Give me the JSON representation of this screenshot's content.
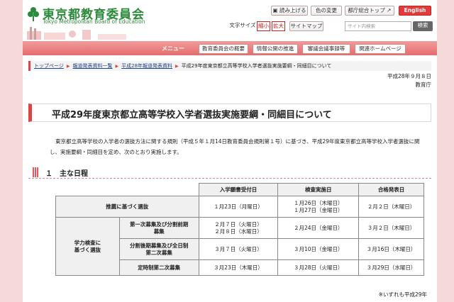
{
  "header": {
    "logo_title": "東京都教育委員会",
    "logo_sub": "Tokyo Metropolitan Board of Education",
    "read_aloud": "読み上げる",
    "color_change": "色の変更",
    "metro_top": "都庁総合トップ",
    "english": "English",
    "font_size_label": "文字サイズ",
    "font_small": "縮小",
    "font_large": "拡大",
    "sitemap": "サイトマップ",
    "search_placeholder": "サイト内検索",
    "search_button": "検索"
  },
  "nav": {
    "menu_label": "メニュー",
    "items": [
      "教育委員会の概要",
      "情報公開の推進",
      "審議会議事録等",
      "関連ホームページ"
    ]
  },
  "breadcrumb": [
    "トップページ",
    "報道発表資料一覧",
    "平成28年報道発表資料",
    "平成29年度東京都立高等学校入学者選抜実施要綱・同細目について"
  ],
  "meta": {
    "date": "平成28年９月８日",
    "org": "教育庁"
  },
  "page_title": "平成29年度東京都立高等学校入学者選抜実施要綱・同細目について",
  "intro": "東京都立高等学校の入学者の選抜方法に関する規則（平成５年１月14日教育委員会規則第１号）に基づき、平成29年度東京都立高等学校入学者選抜に関し、実施要綱・同細目を定め、次のとおり実施します。",
  "section": {
    "num": "１",
    "title": "主な日程"
  },
  "table": {
    "headers": [
      "入学願書受付日",
      "検査実施日",
      "合格発表日"
    ],
    "suisen": {
      "label": "推薦に基づく選抜",
      "apply": "１月23日（月曜日）",
      "exam1": "１月26日（木曜日）",
      "exam2": "１月27日（金曜日）",
      "result": "２月２日（木曜日）"
    },
    "gakuryoku_label_1": "学力検査に",
    "gakuryoku_label_2": "基づく選抜",
    "rows": [
      {
        "name1": "第一次募集及び分割前期",
        "name2": "募集",
        "apply1": "２月７日（火曜日）",
        "apply2": "２月８日（水曜日）",
        "exam": "２月24日（金曜日）",
        "result": "３月２日（木曜日）"
      },
      {
        "name1": "分割後期募集及び全日制",
        "name2": "第二次募集",
        "apply1": "３月７日（火曜日）",
        "apply2": "",
        "exam": "３月10日（金曜日）",
        "result": "３月16日（木曜日）"
      },
      {
        "name1": "定時制第二次募集",
        "name2": "",
        "apply1": "３月23日（木曜日）",
        "apply2": "",
        "exam": "３月28日（火曜日）",
        "result": "３月29日（水曜日）"
      }
    ]
  },
  "footnote": "※いずれも平成29年",
  "colors": {
    "brand_green": "#2c8a3b",
    "accent_red": "#e23b3b",
    "nav_pink": "#e97f7f",
    "background_pink": "#f5dada"
  }
}
